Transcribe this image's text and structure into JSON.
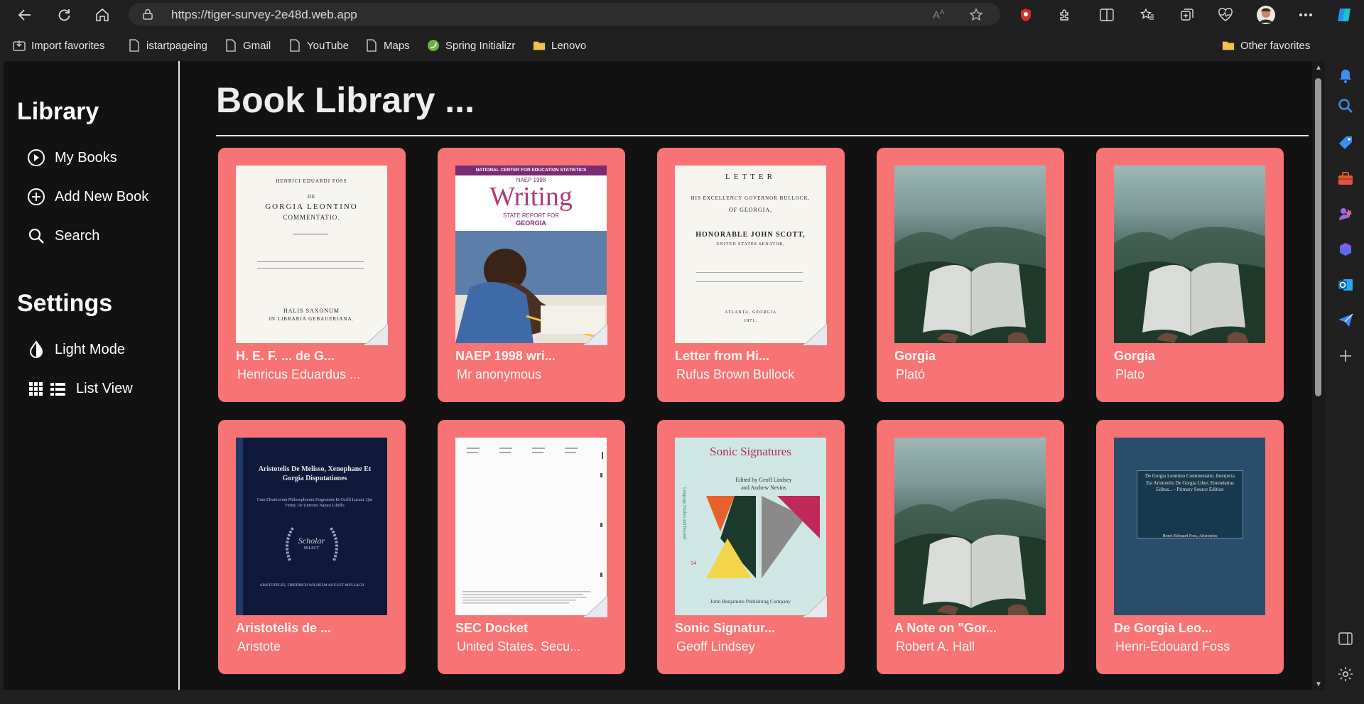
{
  "browser": {
    "url": "https://tiger-survey-2e48d.web.app"
  },
  "favorites": [
    {
      "label": "Import favorites",
      "icon": "import-icon"
    },
    {
      "label": "istartpageing",
      "icon": "page-icon"
    },
    {
      "label": "Gmail",
      "icon": "page-icon"
    },
    {
      "label": "YouTube",
      "icon": "page-icon"
    },
    {
      "label": "Maps",
      "icon": "page-icon"
    },
    {
      "label": "Spring Initializr",
      "icon": "spring-icon"
    },
    {
      "label": "Lenovo",
      "icon": "folder-icon"
    },
    {
      "label": "Other favorites",
      "icon": "folder-icon"
    }
  ],
  "sidebar": {
    "library_heading": "Library",
    "library_items": [
      {
        "label": "My Books",
        "icon": "play-circle-icon"
      },
      {
        "label": "Add New Book",
        "icon": "plus-circle-icon"
      },
      {
        "label": "Search",
        "icon": "search-icon"
      }
    ],
    "settings_heading": "Settings",
    "settings_items": [
      {
        "label": "Light Mode",
        "icon": "contrast-icon"
      },
      {
        "label": "List View",
        "icon": "grid-list-icon"
      }
    ]
  },
  "main": {
    "title": "Book Library ..."
  },
  "books": [
    {
      "title": "H. E. F. ... de G...",
      "author": "Henricus Eduardus ...",
      "cover_style": "paper",
      "cover_text": [
        "HENRICI EDUARDI FOSS",
        "DE",
        "GORGIA LEONTINO",
        "COMMENTATIO.",
        "HALIS SAXONUM",
        "IN LIBRARIA GEBAUERIANA."
      ]
    },
    {
      "title": "NAEP 1998 wri...",
      "author": "Mr anonymous",
      "cover_style": "naep",
      "cover_text": [
        "NATIONAL CENTER FOR EDUCATION STATISTICS",
        "NAEP 1998",
        "Writing",
        "STATE REPORT FOR",
        "GEORGIA"
      ]
    },
    {
      "title": "Letter from Hi...",
      "author": "Rufus Brown Bullock",
      "cover_style": "paper",
      "cover_text": [
        "LETTER",
        "HIS EXCELLENCY GOVERNOR BULLOCK,",
        "OF GEORGIA,",
        "HONORABLE JOHN SCOTT,",
        "UNITED STATES SENATOR,",
        "ATLANTA, GEORGIA",
        "1871."
      ]
    },
    {
      "title": "Gorgia",
      "author": "Plató",
      "cover_style": "mountain",
      "cover_text": []
    },
    {
      "title": "Gorgia",
      "author": "Plato",
      "cover_style": "mountain",
      "cover_text": []
    },
    {
      "title": "Aristotelis de ...",
      "author": "Aristote",
      "cover_style": "navy",
      "cover_text": [
        "Aristotelis De Melisso, Xenophane Et Gorgia Disputationes",
        "Cum Eleaticorum Philosophorum Fragmentis Et Ocelli Lucani, Qui Fertur, De Universi Natura Libello",
        "Scholar",
        "SELECT",
        "ARISTOTELES, FRIEDRICH WILHELM AUGUST MULLACH"
      ]
    },
    {
      "title": "SEC Docket",
      "author": "United States. Secu...",
      "cover_style": "blank",
      "cover_text": []
    },
    {
      "title": "Sonic Signatur...",
      "author": "Geoff Lindsey",
      "cover_style": "sonic",
      "cover_text": [
        "Sonic Signatures",
        "Edited by Geoff Lindsey",
        "and Andrew Nevins",
        "14",
        "John Benjamins Publishing Company"
      ]
    },
    {
      "title": "A Note on \"Gor...",
      "author": "Robert A. Hall",
      "cover_style": "mountain",
      "cover_text": []
    },
    {
      "title": "De Gorgia Leo...",
      "author": "Henri-Edouard Foss",
      "cover_style": "blue",
      "cover_text": [
        "De Gorgia Leontino Commentatio. Interjecta Est Aristotelis De Gorgia Liber, Emendatius Editus... - Primary Source Edition",
        "Henri-Edouard Foss, Aristoteles"
      ]
    }
  ],
  "colors": {
    "card": "#f87373",
    "background": "#121212",
    "sidebar_border": "#e8e8e8"
  }
}
